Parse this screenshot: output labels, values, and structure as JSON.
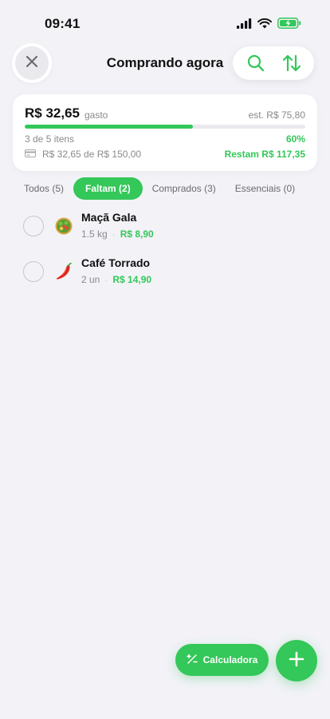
{
  "status_bar": {
    "time": "09:41"
  },
  "header": {
    "title": "Comprando agora"
  },
  "summary": {
    "spent": "R$ 32,65",
    "spent_label": "gasto",
    "estimate": "est. R$ 75,80",
    "progress_fraction": 0.6,
    "items_count": "3 de 5 itens",
    "progress_percent": "60%",
    "budget": "R$ 32,65 de R$ 150,00",
    "remaining": "Restam R$ 117,35"
  },
  "tabs": [
    {
      "label": "Todos (5)",
      "active": false
    },
    {
      "label": "Faltam (2)",
      "active": true
    },
    {
      "label": "Comprados (3)",
      "active": false
    },
    {
      "label": "Essenciais (0)",
      "active": false
    }
  ],
  "items": [
    {
      "name": "Maçã Gala",
      "qty": "1.5 kg",
      "price": "R$ 8,90",
      "icon": "salad-emoji"
    },
    {
      "name": "Café Torrado",
      "qty": "2 un",
      "price": "R$ 14,90",
      "icon": "chili-pepper-emoji"
    }
  ],
  "actions": {
    "calculator_label": "Calculadora"
  },
  "colors": {
    "accent": "#34c759",
    "background": "#f2f2f7",
    "card": "#ffffff"
  }
}
